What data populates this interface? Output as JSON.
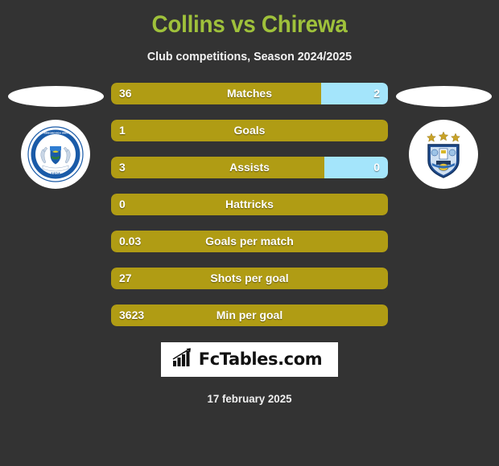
{
  "header": {
    "title": "Collins vs Chirewa",
    "subtitle": "Club competitions, Season 2024/2025",
    "title_color": "#9FC13B"
  },
  "teams": {
    "left": {
      "name_plate": "",
      "crest_name": "peterborough-united-fc-crest",
      "crest_text_top": "PETERBOROUGH UNITED FOOTBALL CLUB",
      "crest_year": "1934",
      "crest_color": "#1A5BA8"
    },
    "right": {
      "name_plate": "",
      "crest_name": "huddersfield-town-afc-crest",
      "crest_stars": 3,
      "crest_color": "#1F4C8F",
      "star_color": "#C8A227"
    }
  },
  "colors": {
    "background": "#333333",
    "bar_left": "#B09C14",
    "bar_right": "#A4E5FB",
    "text": "#ffffff"
  },
  "chart_data": {
    "type": "bar",
    "title": "Collins vs Chirewa",
    "subtitle": "Club competitions, Season 2024/2025",
    "orientation": "horizontal-diverging",
    "series": [
      {
        "name": "Collins",
        "color": "#B09C14"
      },
      {
        "name": "Chirewa",
        "color": "#A4E5FB"
      }
    ],
    "categories": [
      "Matches",
      "Goals",
      "Assists",
      "Hattricks",
      "Goals per match",
      "Shots per goal",
      "Min per goal"
    ],
    "rows": [
      {
        "label": "Matches",
        "left": "36",
        "right": "2",
        "left_pct": 76,
        "right_pct": 24
      },
      {
        "label": "Goals",
        "left": "1",
        "right": "",
        "left_pct": 100,
        "right_pct": 0
      },
      {
        "label": "Assists",
        "left": "3",
        "right": "0",
        "left_pct": 77,
        "right_pct": 23
      },
      {
        "label": "Hattricks",
        "left": "0",
        "right": "",
        "left_pct": 100,
        "right_pct": 0
      },
      {
        "label": "Goals per match",
        "left": "0.03",
        "right": "",
        "left_pct": 100,
        "right_pct": 0
      },
      {
        "label": "Shots per goal",
        "left": "27",
        "right": "",
        "left_pct": 100,
        "right_pct": 0
      },
      {
        "label": "Min per goal",
        "left": "3623",
        "right": "",
        "left_pct": 100,
        "right_pct": 0
      }
    ]
  },
  "footer": {
    "brand": "FcTables.com",
    "brand_icon": "bar-chart-growth-icon",
    "date": "17 february 2025"
  }
}
